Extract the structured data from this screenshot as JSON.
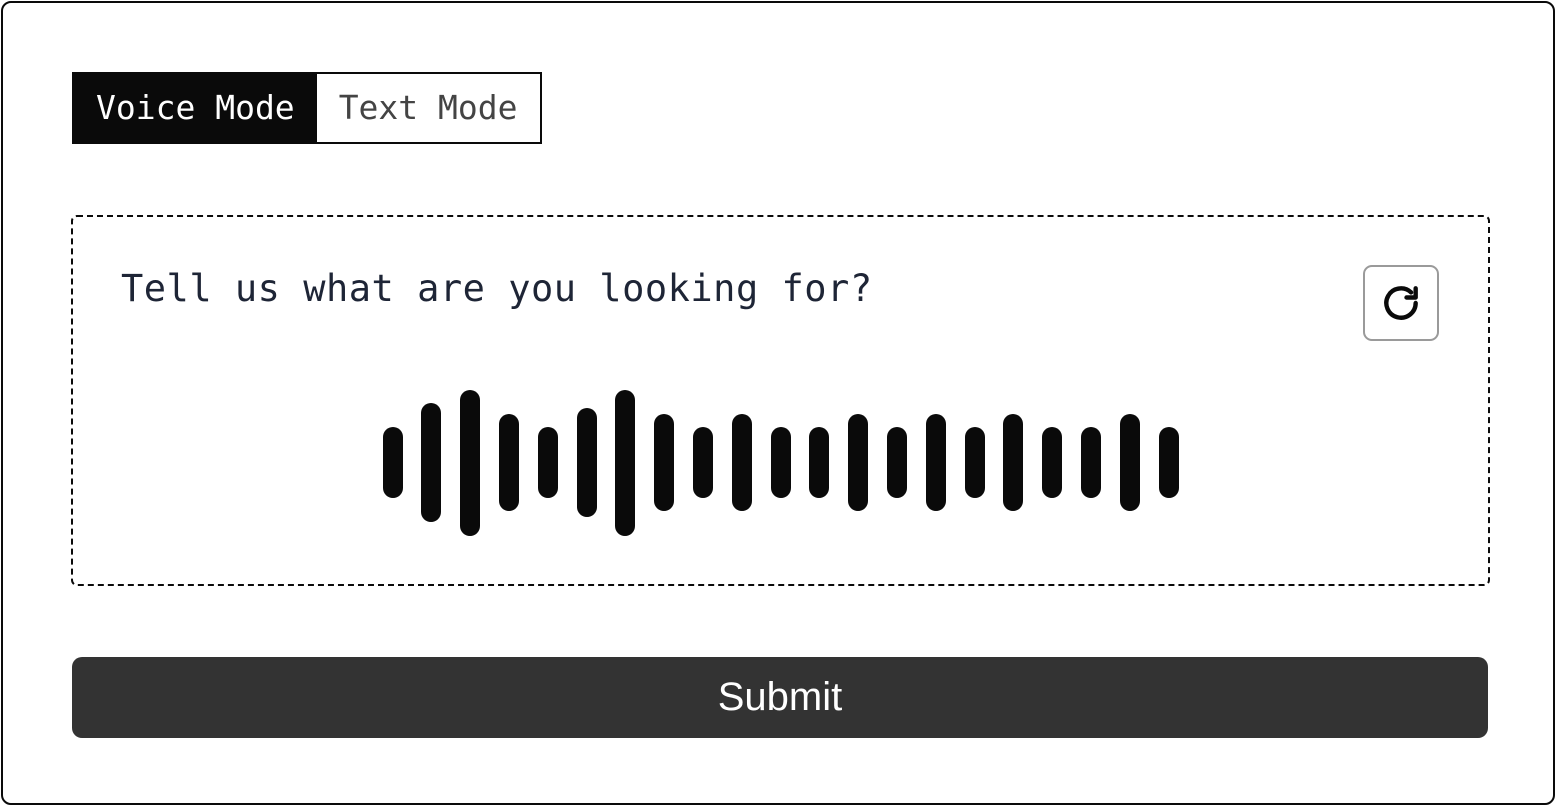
{
  "tabs": [
    {
      "label": "Voice Mode",
      "active": true
    },
    {
      "label": "Text Mode",
      "active": false
    }
  ],
  "voice_panel": {
    "prompt": "Tell us what are you looking for?",
    "refresh_icon": "refresh-icon",
    "waveform_levels": [
      0.49,
      0.82,
      1.0,
      0.67,
      0.49,
      0.75,
      1.0,
      0.67,
      0.49,
      0.67,
      0.49,
      0.49,
      0.67,
      0.49,
      0.67,
      0.49,
      0.67,
      0.49,
      0.49,
      0.67,
      0.49
    ]
  },
  "submit_label": "Submit",
  "colors": {
    "accent": "#0a0a0a",
    "button": "#333333",
    "prompt_text": "#1e2536"
  }
}
